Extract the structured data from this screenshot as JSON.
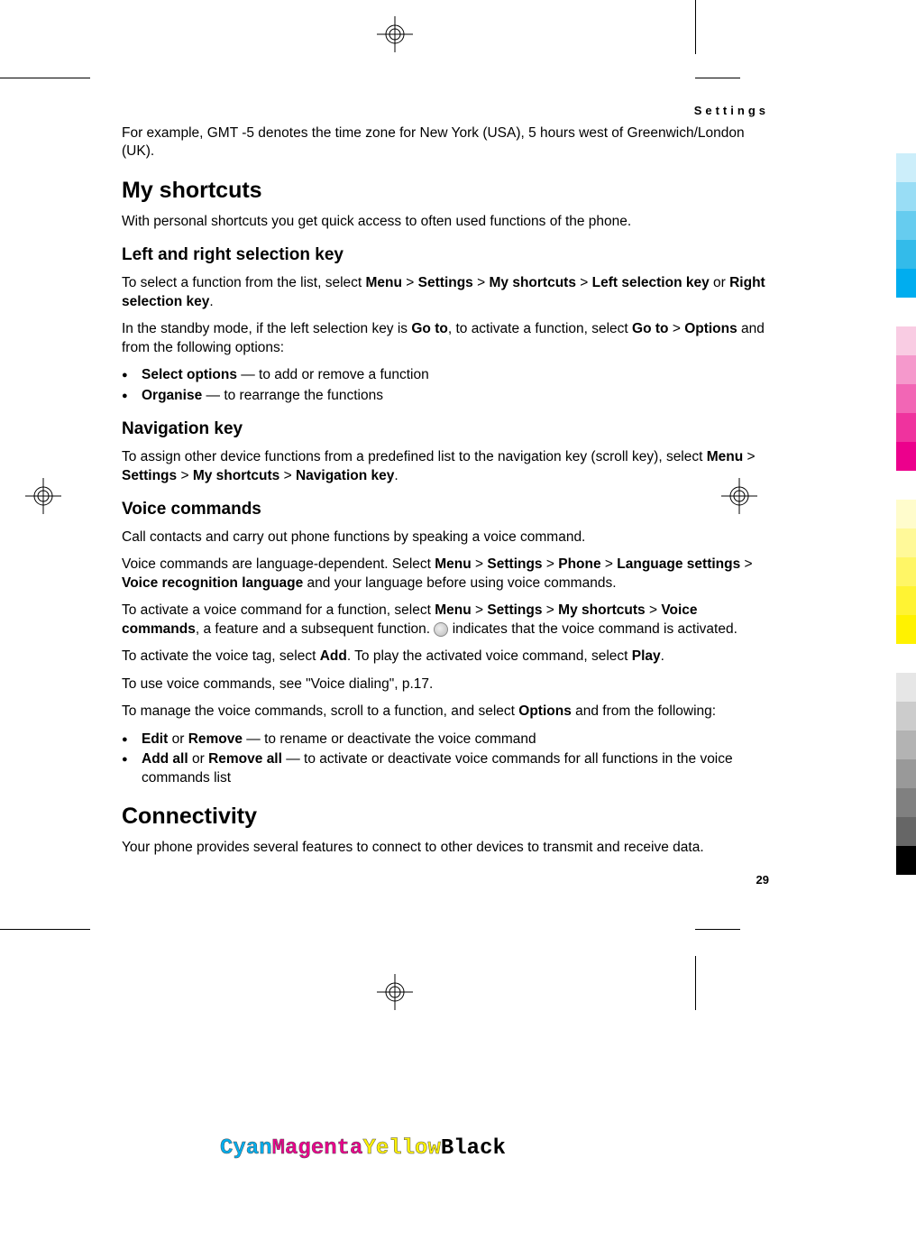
{
  "header": "Settings",
  "intro": "For example, GMT -5 denotes the time zone for New York (USA), 5 hours west of Greenwich/London (UK).",
  "s1": {
    "h": "My shortcuts",
    "p": "With personal shortcuts you get quick access to often used functions of the phone."
  },
  "s2": {
    "h": "Left and right selection key",
    "p1a": "To select a function from the list, select ",
    "p1b": "Menu",
    "gt": " > ",
    "p1c": "Settings",
    "p1d": "My shortcuts",
    "p1e": "Left selection key",
    "or": " or ",
    "p1f": "Right selection key",
    "dot": ".",
    "p2a": "In the standby mode, if the left selection key is ",
    "p2b": "Go to",
    "p2c": ", to activate a function, select ",
    "p2d": "Go to",
    "p2e": "Options",
    "p2f": " and from the following options:",
    "li1a": "Select options",
    "li1b": "  — to add or remove a function",
    "li2a": "Organise",
    "li2b": "  — to rearrange the functions"
  },
  "s3": {
    "h": "Navigation key",
    "p1a": "To assign other device functions from a predefined list to the navigation key (scroll key), select ",
    "p1b": "Menu",
    "p1c": "Settings",
    "p1d": "My shortcuts",
    "p1e": "Navigation key"
  },
  "s4": {
    "h": "Voice commands",
    "p1": "Call contacts and carry out phone functions by speaking a voice command.",
    "p2a": "Voice commands are language-dependent. Select ",
    "p2b": "Menu",
    "p2c": "Settings",
    "p2d": "Phone",
    "p2e": "Language settings",
    "p2f": "Voice recognition language",
    "p2g": " and your language before using voice commands.",
    "p3a": "To activate a voice command for a function, select ",
    "p3b": "Menu",
    "p3c": "Settings",
    "p3d": "My shortcuts",
    "p3e": "Voice commands",
    "p3f": ", a feature and a subsequent function. ",
    "p3g": " indicates that the voice command is activated.",
    "p4a": "To activate the voice tag, select ",
    "p4b": "Add",
    "p4c": ". To play the activated voice command, select ",
    "p4d": "Play",
    "p5": "To use voice commands, see \"Voice dialing\", p.17.",
    "p6a": "To manage the voice commands, scroll to a function, and select ",
    "p6b": "Options",
    "p6c": " and from the following:",
    "li1a": "Edit",
    "li1b": "Remove",
    "li1c": " — to rename or deactivate the voice command",
    "li2a": "Add all",
    "li2b": "Remove all",
    "li2c": " — to activate or deactivate voice commands for all functions in the voice commands list"
  },
  "s5": {
    "h": "Connectivity",
    "p": "Your phone provides several features to connect to other devices to transmit and receive data."
  },
  "pageNum": "29",
  "cmyk": {
    "c": "Cyan",
    "m": "Magenta",
    "y": "Yellow",
    "k": "Black"
  },
  "colors": [
    "#CCEEFA",
    "#99DDF5",
    "#66CCEF",
    "#33BBEA",
    "#00ADEF",
    "#FFFFFF",
    "#F9CCE3",
    "#F599CC",
    "#F266B5",
    "#EF339E",
    "#EC008C",
    "#FFFFFF",
    "#FFFCCC",
    "#FFF999",
    "#FFF666",
    "#FFF333",
    "#FFF200",
    "#FFFFFF",
    "#E6E6E6",
    "#CCCCCC",
    "#B3B3B3",
    "#999999",
    "#808080",
    "#666666",
    "#000000"
  ]
}
